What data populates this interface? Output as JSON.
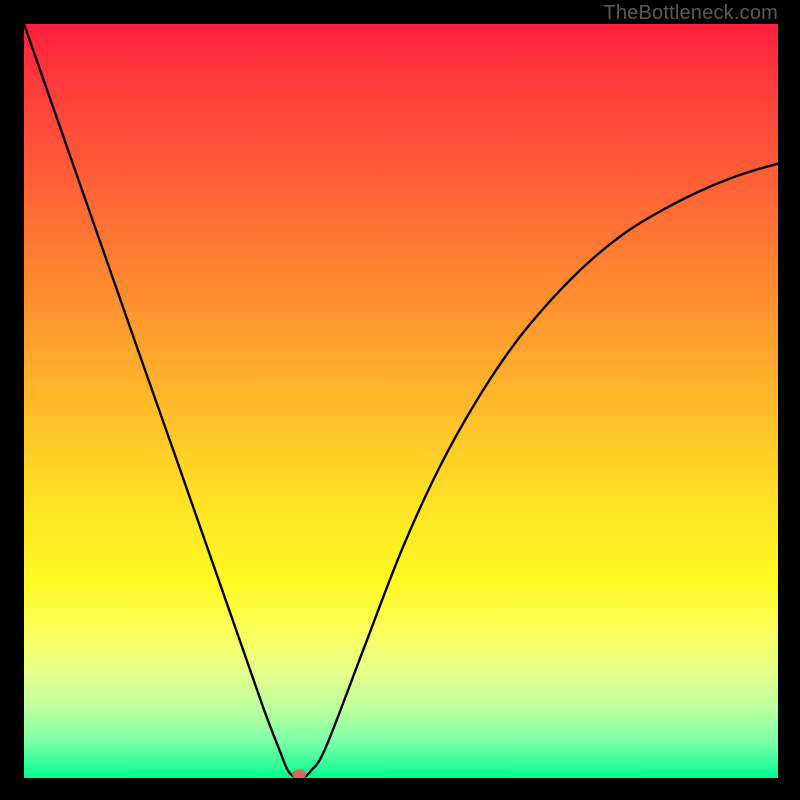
{
  "watermark": "TheBottleneck.com",
  "chart_data": {
    "type": "line",
    "title": "",
    "xlabel": "",
    "ylabel": "",
    "xlim": [
      0,
      100
    ],
    "ylim": [
      0,
      100
    ],
    "series": [
      {
        "name": "curve",
        "x": [
          0,
          5,
          10,
          15,
          20,
          25,
          30,
          32,
          34,
          35,
          36,
          37,
          38,
          40,
          45,
          50,
          55,
          60,
          65,
          70,
          75,
          80,
          85,
          90,
          95,
          100
        ],
        "values": [
          100,
          85.7,
          71.4,
          57.1,
          42.9,
          28.6,
          14.3,
          8.6,
          3.4,
          1.0,
          0.1,
          0.1,
          0.9,
          4.0,
          17.0,
          30.0,
          41.0,
          50.0,
          57.5,
          63.5,
          68.5,
          72.5,
          75.5,
          78.0,
          80.0,
          81.5
        ]
      }
    ],
    "marker": {
      "x": 36.5,
      "y": 0.5
    },
    "gradient_bands": [
      "red",
      "orange",
      "yellow",
      "green"
    ]
  }
}
